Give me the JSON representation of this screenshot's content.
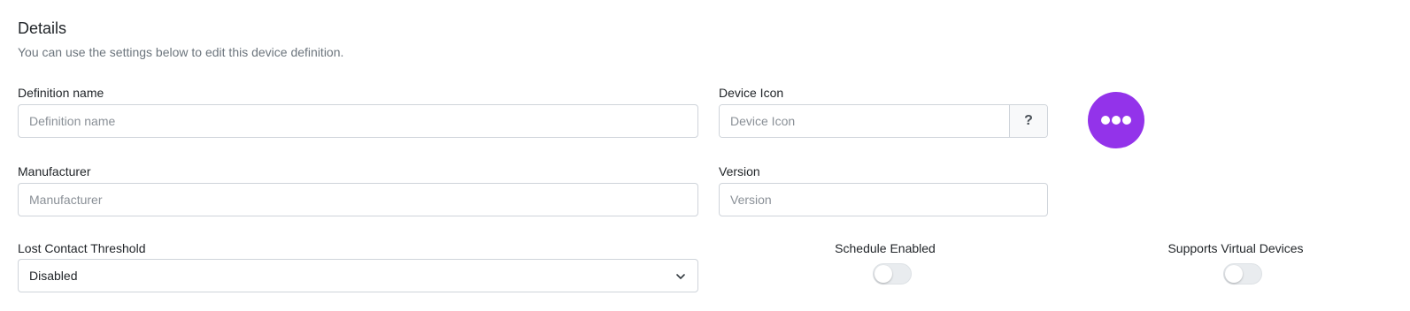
{
  "section": {
    "title": "Details",
    "subtitle": "You can use the settings below to edit this device definition."
  },
  "fields": {
    "definition_name": {
      "label": "Definition name",
      "placeholder": "Definition name",
      "value": ""
    },
    "device_icon": {
      "label": "Device Icon",
      "placeholder": "Device Icon",
      "value": "",
      "help_label": "?"
    },
    "manufacturer": {
      "label": "Manufacturer",
      "placeholder": "Manufacturer",
      "value": ""
    },
    "version": {
      "label": "Version",
      "placeholder": "Version",
      "value": ""
    },
    "lost_contact_threshold": {
      "label": "Lost Contact Threshold",
      "selected": "Disabled"
    },
    "schedule_enabled": {
      "label": "Schedule Enabled",
      "on": false
    },
    "supports_virtual_devices": {
      "label": "Supports Virtual Devices",
      "on": false
    }
  },
  "icon_preview": {
    "icon": "more-horizontal-icon",
    "color": "#9333ea"
  },
  "colors": {
    "accent": "#9333ea",
    "border": "#cfd4da",
    "muted_text": "#6c757d"
  }
}
